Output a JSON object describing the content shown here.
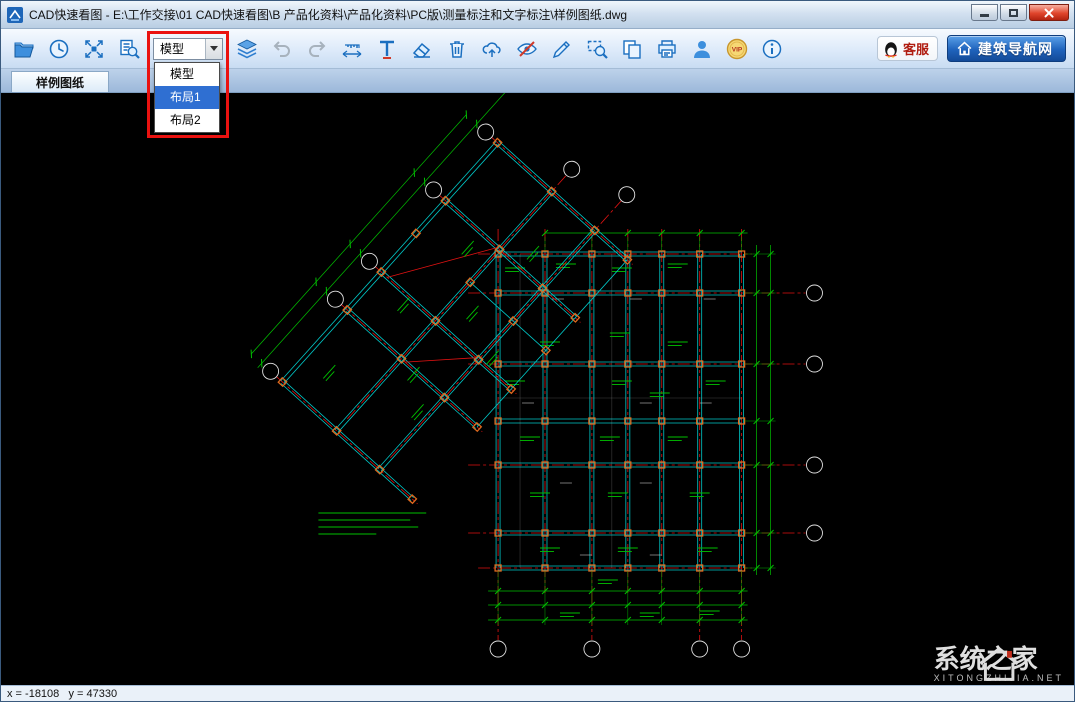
{
  "window": {
    "title": "CAD快速看图 - E:\\工作交接\\01 CAD快速看图\\B 产品化资料\\产品化资料\\PC版\\测量标注和文字标注\\样例图纸.dwg"
  },
  "toolbar": {
    "layout_selector": {
      "value": "模型",
      "options": [
        "模型",
        "布局1",
        "布局2"
      ],
      "highlighted_option": "布局1"
    },
    "vip_label": "VIP",
    "customer_service_label": "客服",
    "nav_site_label": "建筑导航网"
  },
  "tabs": {
    "active": "样例图纸"
  },
  "statusbar": {
    "coordinates": "x = -18108   y = 47330"
  },
  "watermark": {
    "title": "系统之家",
    "subtitle": "XITONGZHIJIA.NET"
  },
  "accent_colors": {
    "highlight_box": "#ea1210",
    "selection_blue": "#2f6fd2",
    "cad_axis_red": "#e01212",
    "cad_beam_cyan": "#00c8c8",
    "cad_dim_green": "#00c000"
  }
}
